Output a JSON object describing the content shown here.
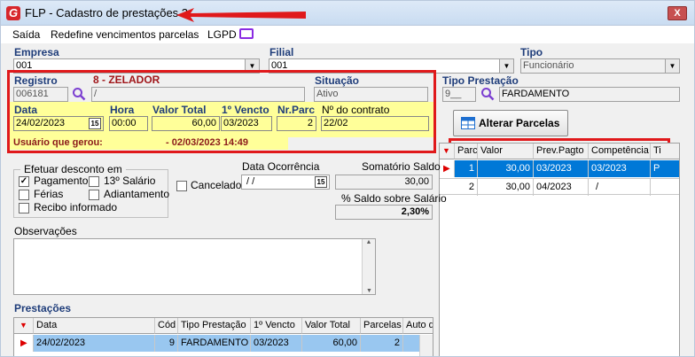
{
  "window": {
    "title": "FLP - Cadastro de prestações 2",
    "close_label": "X"
  },
  "menu": [
    {
      "label": "Saída"
    },
    {
      "label": "Redefine vencimentos parcelas"
    },
    {
      "label": "LGPD"
    }
  ],
  "header": {
    "empresa_label": "Empresa",
    "empresa_value": "001",
    "filial_label": "Filial",
    "filial_value": "001",
    "tipo_label": "Tipo",
    "tipo_value": "Funcionário"
  },
  "registro": {
    "label": "Registro",
    "value": "006181",
    "name": "8 - ZELADOR",
    "name_field": "/",
    "situacao_label": "Situação",
    "situacao_value": "Ativo",
    "tipo_prestacao_label": "Tipo Prestação",
    "tipo_prestacao_code": "9__",
    "tipo_prestacao_value": "FARDAMENTO"
  },
  "main_fields": {
    "data_label": "Data",
    "data_value": "24/02/2023",
    "calendar_icon": "15",
    "hora_label": "Hora",
    "hora_value": "00:00",
    "valor_total_label": "Valor Total",
    "valor_total_value": "60,00",
    "primeiro_vencto_label": "1º Vencto",
    "primeiro_vencto_value": "03/2023",
    "nr_parc_label": "Nr.Parc",
    "nr_parc_value": "2",
    "contrato_label": "Nº do contrato",
    "contrato_value": "22/02"
  },
  "user_bar": {
    "label": "Usuário que gerou:",
    "value": "- 02/03/2023 14:49"
  },
  "alterar_parcelas_label": "Alterar Parcelas",
  "desconto": {
    "group_label": "Efetuar desconto em",
    "options": [
      {
        "label": "Pagamento",
        "checked": true
      },
      {
        "label": "13º Salário",
        "checked": false
      },
      {
        "label": "Férias",
        "checked": false
      },
      {
        "label": "Adiantamento",
        "checked": false
      },
      {
        "label": "Recibo informado",
        "checked": false
      }
    ]
  },
  "cancelado_label": "Cancelado",
  "data_ocorrencia": {
    "label": "Data Ocorrência",
    "value": " / /",
    "calendar_icon": "15"
  },
  "somatorio": {
    "label": "Somatório Saldo",
    "value": "30,00",
    "pct_label": "% Saldo sobre Salário",
    "pct_value": "2,30%"
  },
  "observacoes_label": "Observações",
  "parcelas_grid": {
    "columns": [
      "Parc",
      "Valor",
      "Prev.Pagto",
      "Competência",
      "Ti"
    ],
    "rows": [
      {
        "parc": "1",
        "valor": "30,00",
        "prev": "03/2023",
        "comp": "03/2023",
        "tipo": "P"
      },
      {
        "parc": "2",
        "valor": "30,00",
        "prev": "04/2023",
        "comp": " /",
        "tipo": ""
      }
    ]
  },
  "prestacoes": {
    "label": "Prestações",
    "columns": [
      "Data",
      "Cód",
      "Tipo Prestação",
      "1º Vencto",
      "Valor Total",
      "Parcelas",
      "Auto d"
    ],
    "rows": [
      {
        "data": "24/02/2023",
        "cod": "9",
        "tipo": "FARDAMENTO",
        "vencto": "03/2023",
        "valor": "60,00",
        "parcelas": "2",
        "auto": ""
      }
    ]
  },
  "colors": {
    "highlight": "#e0191b",
    "yellow": "#ffff99",
    "selection": "#0078d7"
  }
}
